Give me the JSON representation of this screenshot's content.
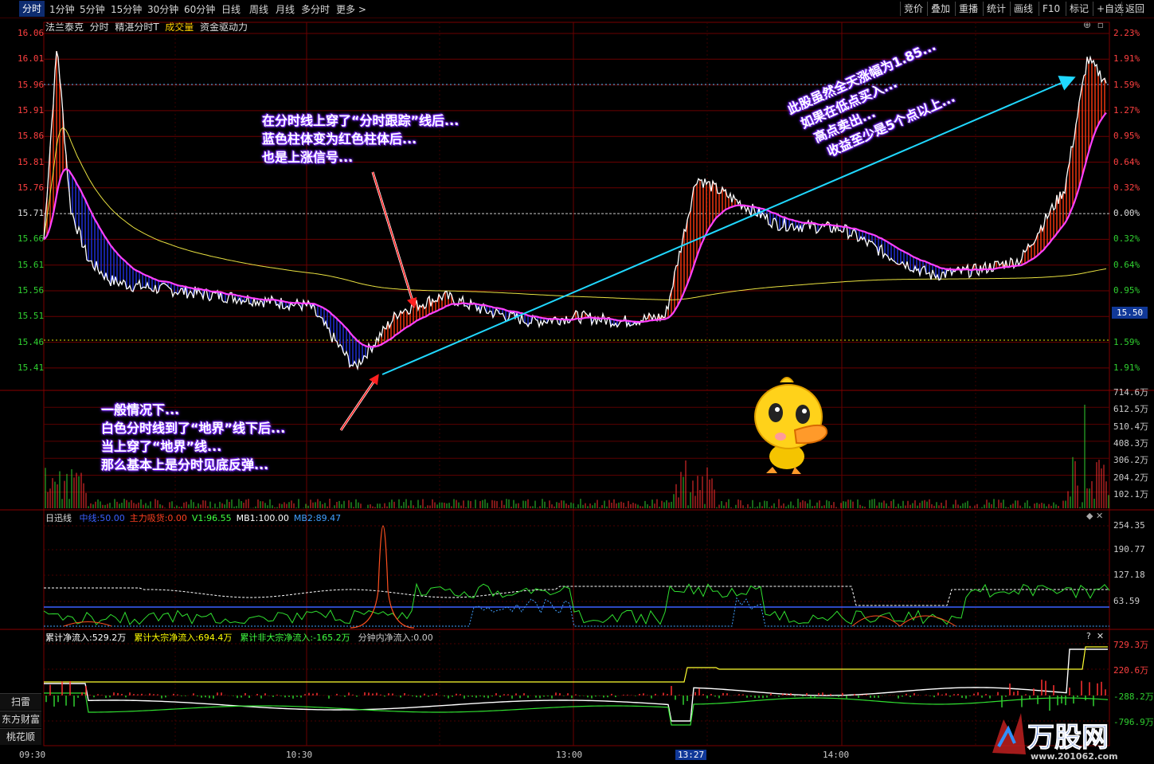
{
  "topbar": {
    "periods": [
      "分时",
      "1分钟",
      "5分钟",
      "15分钟",
      "30分钟",
      "60分钟",
      "日线",
      "周线",
      "月线",
      "多分时",
      "更多 >"
    ],
    "active": "分时",
    "right_buttons": [
      "竞价",
      "叠加",
      "重播",
      "统计",
      "画线",
      "F10",
      "标记",
      "+自选",
      "返回"
    ]
  },
  "chart_header": {
    "stock_name": "法兰泰克",
    "mode": "分时",
    "indicator_name": "精湛分时T",
    "volume_label": "成交量",
    "flow_label": "资金驱动力"
  },
  "price_axis": {
    "left_ticks": [
      "16.06",
      "16.01",
      "15.96",
      "15.91",
      "15.86",
      "15.81",
      "15.76",
      "15.71",
      "15.66",
      "15.61",
      "15.56",
      "15.51",
      "15.46",
      "15.41"
    ],
    "right_ticks": [
      "2.23%",
      "1.91%",
      "1.59%",
      "1.27%",
      "0.95%",
      "0.64%",
      "0.32%",
      "0.00%",
      "0.32%",
      "0.64%",
      "0.95%",
      "",
      "1.59%",
      "1.91%"
    ],
    "current_price_tag": "15.50"
  },
  "volume_axis": {
    "right_ticks": [
      "714.6万",
      "612.5万",
      "510.4万",
      "408.3万",
      "306.2万",
      "204.2万",
      "102.1万"
    ]
  },
  "indicator1": {
    "name": "日迅线",
    "items": [
      {
        "label": "中线:",
        "value": "50.00",
        "color": "#3a60ff"
      },
      {
        "label": "主力吸货:",
        "value": "0.00",
        "color": "#ff4020"
      },
      {
        "label": "V1:",
        "value": "96.55",
        "color": "#40ff40"
      },
      {
        "label": "MB1:",
        "value": "100.00",
        "color": "#ffffff"
      },
      {
        "label": "MB2:",
        "value": "89.47",
        "color": "#40a0ff"
      }
    ],
    "right_ticks": [
      "254.35",
      "190.77",
      "127.18",
      "63.59"
    ]
  },
  "indicator2": {
    "items": [
      {
        "label": "累计净流入:",
        "value": "529.2万",
        "color": "#ffffff"
      },
      {
        "label": "累计大宗净流入:",
        "value": "694.4万",
        "color": "#ffff00"
      },
      {
        "label": "累计非大宗净流入:",
        "value": "-165.2万",
        "color": "#40ff40"
      },
      {
        "label": "分钟内净流入:",
        "value": "0.00",
        "color": "#cccccc"
      }
    ],
    "right_ticks": [
      "729.3万",
      "220.6万",
      "-288.2万",
      "-796.9万"
    ]
  },
  "time_axis": {
    "labels": [
      "09:30",
      "10:30",
      "13:00",
      "13:27",
      "14:00"
    ],
    "highlight": "13:27"
  },
  "side_buttons": [
    "扫雷",
    "东方财富",
    "桃花顺"
  ],
  "annotations": {
    "a1": [
      "在分时线上穿了“分时跟踪”线后...",
      "蓝色柱体变为红色柱体后...",
      "也是上涨信号..."
    ],
    "a2": [
      "一般情况下...",
      "白色分时线到了“地界”线下后...",
      "当上穿了“地界”线...",
      "那么基本上是分时见底反弹..."
    ],
    "a3": [
      "此股虽然全天涨幅为1.85...",
      "如果在低点买入...",
      "高点卖出...",
      "收益至少是5个点以上..."
    ]
  },
  "watermark": {
    "brand": "万股网",
    "url": "www.201062.com"
  },
  "chart_data": {
    "type": "line",
    "y_reference_price": 15.71,
    "ylim": [
      15.37,
      16.06
    ],
    "series": [
      {
        "name": "",
        "color": "#ffffff",
        "x": [
          "09:30",
          "09:33",
          "09:36",
          "09:40",
          "09:45",
          "09:50",
          "10:00",
          "10:10",
          "10:20",
          "10:30",
          "10:40",
          "10:50",
          "11:00",
          "11:10",
          "11:20",
          "11:30",
          "13:00",
          "13:10",
          "13:20",
          "13:27",
          "13:35",
          "13:45",
          "14:00",
          "14:10",
          "14:20",
          "14:30",
          "14:40",
          "14:50",
          "14:55",
          "15:00"
        ],
        "values": [
          15.66,
          16.04,
          15.72,
          15.62,
          15.58,
          15.57,
          15.56,
          15.55,
          15.54,
          15.53,
          15.41,
          15.52,
          15.55,
          15.52,
          15.5,
          15.51,
          15.51,
          15.5,
          15.51,
          15.78,
          15.74,
          15.69,
          15.68,
          15.63,
          15.59,
          15.6,
          15.62,
          15.76,
          16.01,
          15.96
        ]
      }
    ]
  }
}
